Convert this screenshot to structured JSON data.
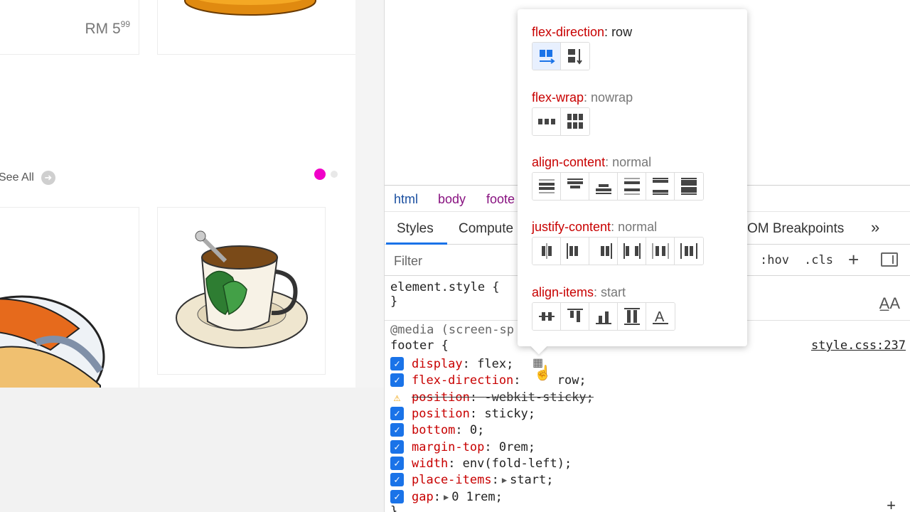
{
  "page_preview": {
    "price_main": "RM 5",
    "price_cents": "99",
    "see_all": "See All",
    "arrow_icon": "arrow-right-icon"
  },
  "devtools": {
    "breadcrumbs": [
      "html",
      "body",
      "foote"
    ],
    "tabs": [
      "Styles",
      "Compute",
      "OM Breakpoints"
    ],
    "more_tabs": "»",
    "filter_placeholder": "Filter",
    "hov": ":hov",
    "cls": ".cls",
    "element_style": "element.style {",
    "close_brace": "}",
    "media_query": "@media (screen-sp",
    "selector": "footer {",
    "source": "style.css:237",
    "decls": [
      {
        "prop": "display",
        "value": "flex;",
        "checked": true
      },
      {
        "prop": "flex-direction",
        "value": "row;",
        "checked": true
      },
      {
        "prop": "position",
        "value": "-webkit-sticky;",
        "checked": false,
        "warning": true
      },
      {
        "prop": "position",
        "value": "sticky;",
        "checked": true
      },
      {
        "prop": "bottom",
        "value": "0;",
        "checked": true
      },
      {
        "prop": "margin-top",
        "value": "0rem;",
        "checked": true
      },
      {
        "prop": "width",
        "value": "env(fold-left);",
        "checked": true
      },
      {
        "prop": "place-items",
        "value": "start;",
        "checked": true,
        "expandable": true
      },
      {
        "prop": "gap",
        "value": "0 1rem;",
        "checked": true,
        "expandable": true
      }
    ]
  },
  "flex_editor": {
    "flex_direction": {
      "label": "flex-direction",
      "value": "row"
    },
    "flex_wrap": {
      "label": "flex-wrap",
      "value": "nowrap"
    },
    "align_content": {
      "label": "align-content",
      "value": "normal"
    },
    "justify_content": {
      "label": "justify-content",
      "value": "normal"
    },
    "align_items": {
      "label": "align-items",
      "value": "start"
    }
  },
  "colors": {
    "accent": "#1a73e8",
    "property_red": "#c80000",
    "pager_active": "#f000c8"
  }
}
